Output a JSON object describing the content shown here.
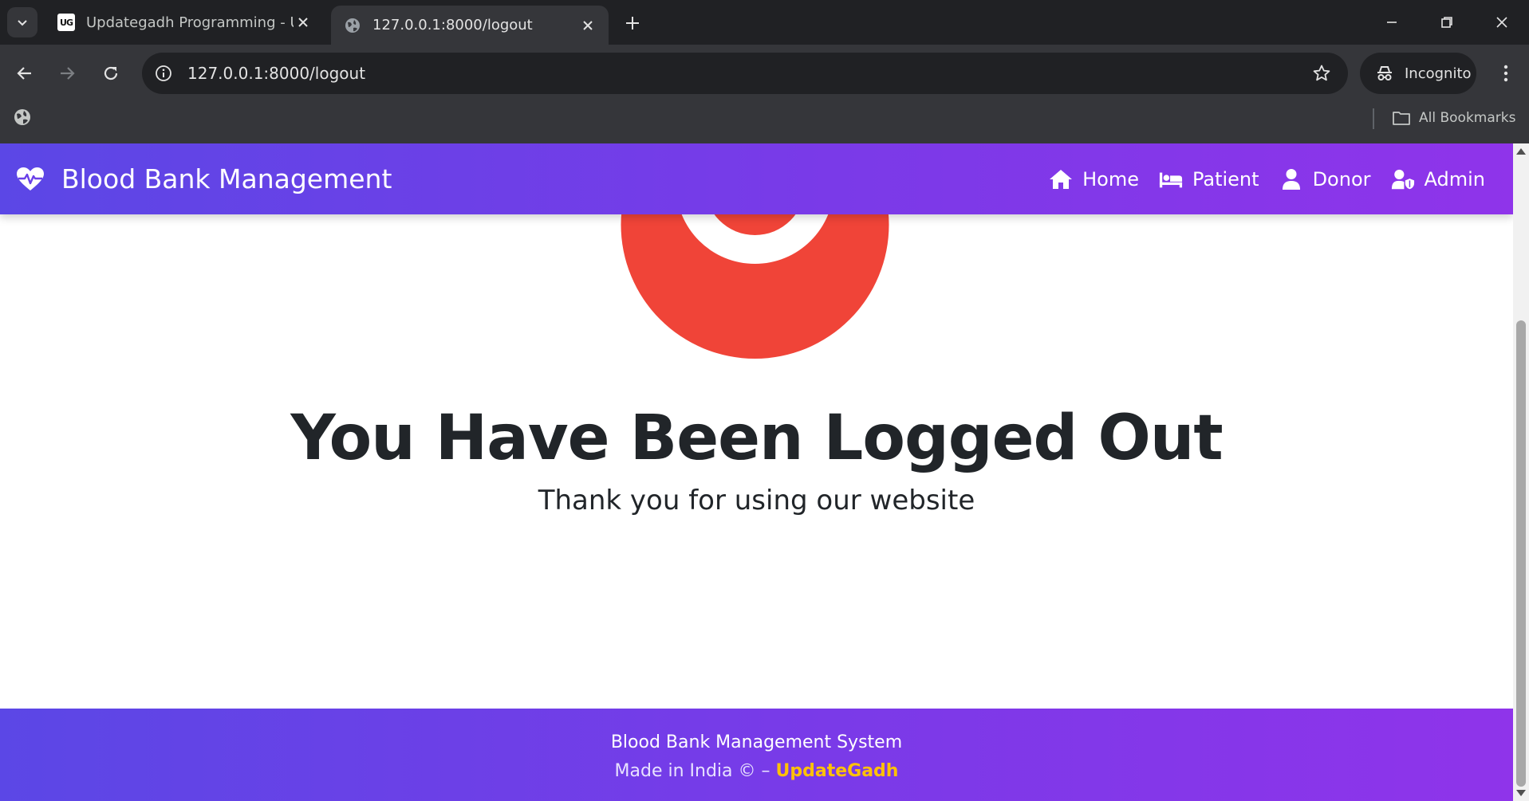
{
  "browser": {
    "tabs": [
      {
        "title": "Updategadh Programming - Up",
        "favicon": "UG",
        "active": false
      },
      {
        "title": "127.0.0.1:8000/logout",
        "favicon": "globe-icon",
        "active": true
      }
    ],
    "address": "127.0.0.1:8000/logout",
    "incognito_label": "Incognito",
    "bookmarks_label": "All Bookmarks"
  },
  "site": {
    "brand": "Blood Bank Management",
    "nav": [
      {
        "label": "Home",
        "icon": "home-icon"
      },
      {
        "label": "Patient",
        "icon": "bed-icon"
      },
      {
        "label": "Donor",
        "icon": "user-icon"
      },
      {
        "label": "Admin",
        "icon": "user-shield-icon"
      }
    ],
    "headline": "You Have Been Logged Out",
    "subhead": "Thank you for using our website",
    "footer": {
      "line1": "Blood Bank Management System",
      "line2_prefix": "Made in India © – ",
      "line2_link": "UpdateGadh"
    }
  },
  "colors": {
    "accent_start": "#5b47e6",
    "accent_end": "#8f34ea",
    "logout_red": "#f04438",
    "footer_link": "#ffc107",
    "text_dark": "#212529"
  }
}
